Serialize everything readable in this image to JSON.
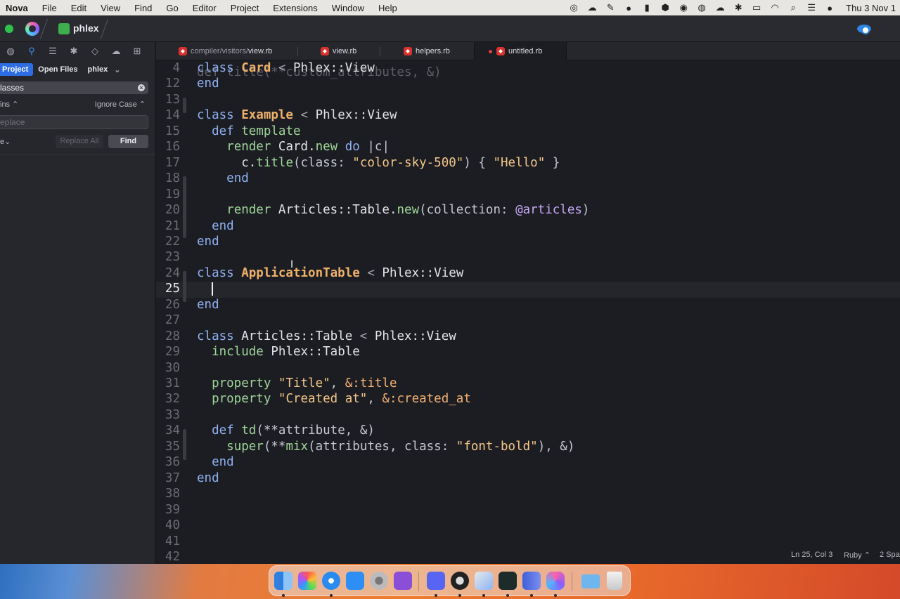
{
  "menubar": {
    "app": "Nova",
    "items": [
      "File",
      "Edit",
      "View",
      "Find",
      "Go",
      "Editor",
      "Project",
      "Extensions",
      "Window",
      "Help"
    ],
    "clock": "Thu 3 Nov 1"
  },
  "titlebar": {
    "project": "phlex"
  },
  "sidebar": {
    "tabs": [
      "Project",
      "Open Files",
      "phlex"
    ],
    "find_value": "lasses",
    "option_left": "ins ⌃",
    "option_right": "Ignore Case ⌃",
    "replace_placeholder": "eplace",
    "scope": "e⌄",
    "replace_all_label": "Replace All",
    "find_label": "Find"
  },
  "tabs": [
    {
      "dir": "compiler/visitors/",
      "name": "view.rb",
      "active": false
    },
    {
      "dir": "",
      "name": "view.rb",
      "active": false
    },
    {
      "dir": "",
      "name": "helpers.rb",
      "active": false
    },
    {
      "dir": "",
      "name": "untitled.rb",
      "active": true,
      "modified": true
    }
  ],
  "editor": {
    "ghost_line": "def title(**custom_attributes, &)",
    "lines": [
      {
        "n": "4",
        "tokens": [
          [
            "kw",
            "class "
          ],
          [
            "cls",
            "Card"
          ],
          [
            "op",
            " < "
          ],
          [
            "",
            "Phlex::View"
          ]
        ]
      },
      {
        "n": "12",
        "tokens": [
          [
            "kw",
            "end"
          ]
        ]
      },
      {
        "n": "13",
        "tokens": []
      },
      {
        "n": "14",
        "tokens": [
          [
            "kw",
            "class "
          ],
          [
            "cls",
            "Example"
          ],
          [
            "op",
            " < "
          ],
          [
            "",
            "Phlex::View"
          ]
        ]
      },
      {
        "n": "15",
        "tokens": [
          [
            "",
            "  "
          ],
          [
            "kw",
            "def "
          ],
          [
            "mth",
            "template"
          ]
        ]
      },
      {
        "n": "16",
        "tokens": [
          [
            "",
            "    "
          ],
          [
            "mth",
            "render "
          ],
          [
            "",
            "Card."
          ],
          [
            "mth",
            "new "
          ],
          [
            "kw",
            "do "
          ],
          [
            "par",
            "|c|"
          ]
        ]
      },
      {
        "n": "17",
        "tokens": [
          [
            "",
            "      c."
          ],
          [
            "mth",
            "title"
          ],
          [
            "par",
            "(class: "
          ],
          [
            "str",
            "\"color-sky-500\""
          ],
          [
            "par",
            ") { "
          ],
          [
            "str",
            "\"Hello\""
          ],
          [
            "par",
            " }"
          ]
        ]
      },
      {
        "n": "18",
        "tokens": [
          [
            "",
            "    "
          ],
          [
            "kw",
            "end"
          ]
        ]
      },
      {
        "n": "19",
        "tokens": []
      },
      {
        "n": "20",
        "tokens": [
          [
            "",
            "    "
          ],
          [
            "mth",
            "render "
          ],
          [
            "",
            "Articles::Table."
          ],
          [
            "mth",
            "new"
          ],
          [
            "par",
            "(collection: "
          ],
          [
            "ivar",
            "@articles"
          ],
          [
            "par",
            ")"
          ]
        ]
      },
      {
        "n": "21",
        "tokens": [
          [
            "",
            "  "
          ],
          [
            "kw",
            "end"
          ]
        ]
      },
      {
        "n": "22",
        "tokens": [
          [
            "kw",
            "end"
          ]
        ]
      },
      {
        "n": "23",
        "tokens": []
      },
      {
        "n": "24",
        "tokens": [
          [
            "kw",
            "class "
          ],
          [
            "cls",
            "ApplicationTable"
          ],
          [
            "op",
            " < "
          ],
          [
            "",
            "Phlex::View"
          ]
        ]
      },
      {
        "n": "25",
        "tokens": [
          [
            "",
            "  "
          ]
        ],
        "current": true
      },
      {
        "n": "26",
        "tokens": [
          [
            "kw",
            "end"
          ]
        ]
      },
      {
        "n": "27",
        "tokens": []
      },
      {
        "n": "28",
        "tokens": [
          [
            "kw",
            "class "
          ],
          [
            "",
            "Articles::Table"
          ],
          [
            "op",
            " < "
          ],
          [
            "",
            "Phlex::View"
          ]
        ]
      },
      {
        "n": "29",
        "tokens": [
          [
            "",
            "  "
          ],
          [
            "mth",
            "include "
          ],
          [
            "",
            "Phlex::Table"
          ]
        ]
      },
      {
        "n": "30",
        "tokens": []
      },
      {
        "n": "31",
        "tokens": [
          [
            "",
            "  "
          ],
          [
            "mth",
            "property "
          ],
          [
            "str",
            "\"Title\""
          ],
          [
            "par",
            ", "
          ],
          [
            "sym",
            "&:title"
          ]
        ]
      },
      {
        "n": "32",
        "tokens": [
          [
            "",
            "  "
          ],
          [
            "mth",
            "property "
          ],
          [
            "str",
            "\"Created at\""
          ],
          [
            "par",
            ", "
          ],
          [
            "sym",
            "&:created_at"
          ]
        ]
      },
      {
        "n": "33",
        "tokens": []
      },
      {
        "n": "34",
        "tokens": [
          [
            "",
            "  "
          ],
          [
            "kw",
            "def "
          ],
          [
            "mth",
            "td"
          ],
          [
            "par",
            "(**attribute, &)"
          ]
        ]
      },
      {
        "n": "35",
        "tokens": [
          [
            "",
            "    "
          ],
          [
            "mth",
            "super"
          ],
          [
            "par",
            "(**"
          ],
          [
            "mth",
            "mix"
          ],
          [
            "par",
            "(attributes, class: "
          ],
          [
            "str",
            "\"font-bold\""
          ],
          [
            "par",
            "), &)"
          ]
        ]
      },
      {
        "n": "36",
        "tokens": [
          [
            "",
            "  "
          ],
          [
            "kw",
            "end"
          ]
        ]
      },
      {
        "n": "37",
        "tokens": [
          [
            "kw",
            "end"
          ]
        ]
      },
      {
        "n": "38",
        "tokens": []
      },
      {
        "n": "39",
        "tokens": []
      },
      {
        "n": "40",
        "tokens": []
      },
      {
        "n": "41",
        "tokens": []
      },
      {
        "n": "42",
        "tokens": []
      }
    ]
  },
  "statusbar": {
    "position": "Ln 25, Col 3",
    "language": "Ruby ⌃",
    "indent": "2 Spa"
  },
  "dock": {
    "apps": [
      "finder-icon",
      "launchpad-icon",
      "safari-icon",
      "app-store-icon",
      "system-settings-icon",
      "feedback-icon",
      "discord-icon",
      "obs-icon",
      "nova-helper-icon",
      "terminal-icon",
      "notes-icon",
      "nova-icon",
      "downloads-folder-icon",
      "trash-icon"
    ]
  },
  "colors": {
    "keyword": "#8fb1f2",
    "class_name": "#f0b26b",
    "string": "#f4c78a",
    "method": "#9fd79a",
    "accent": "#2d6ee5"
  }
}
